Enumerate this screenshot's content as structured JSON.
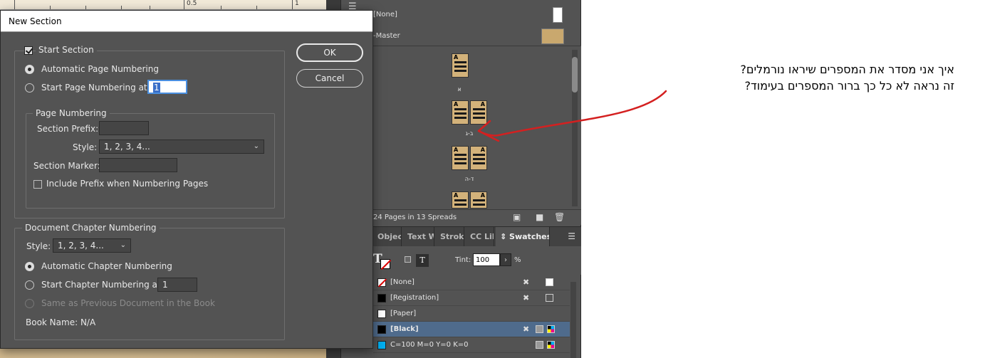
{
  "dialog": {
    "title": "New Section",
    "start_section_label": "Start Section",
    "auto_page_label": "Automatic Page Numbering",
    "start_page_label": "Start Page Numbering at:",
    "start_page_value": "1",
    "ok_label": "OK",
    "cancel_label": "Cancel",
    "page_numbering": {
      "group_label": "Page Numbering",
      "section_prefix_label": "Section Prefix:",
      "section_prefix_value": "",
      "style_label": "Style:",
      "style_value": "1, 2, 3, 4...",
      "section_marker_label": "Section Marker:",
      "section_marker_value": "",
      "include_prefix_label": "Include Prefix when Numbering Pages"
    },
    "chapter_numbering": {
      "group_label": "Document Chapter Numbering",
      "style_label": "Style:",
      "style_value": "1, 2, 3, 4...",
      "auto_chapter_label": "Automatic Chapter Numbering",
      "start_chapter_label": "Start Chapter Numbering at:",
      "start_chapter_value": "1",
      "same_as_prev_label": "Same as Previous Document in the Book",
      "book_name_label": "Book Name: N/A"
    }
  },
  "ruler": {
    "marks": [
      "0.5",
      "1"
    ]
  },
  "pages_panel": {
    "none_row": "[None]",
    "master_row": "-Master",
    "status": "24 Pages in 13 Spreads",
    "spread_labels": [
      "א",
      "ב-ג",
      "ד-ה"
    ],
    "thumb_marker": "A"
  },
  "panel_tabs": [
    "Object",
    "Text W",
    "Stroke",
    "CC Lib",
    "Swatches"
  ],
  "swatches": {
    "tint_label": "Tint:",
    "tint_value": "100",
    "tint_unit": "%",
    "tool_letter": "T",
    "items": [
      {
        "name": "[None]",
        "color": "none"
      },
      {
        "name": "[Registration]",
        "color": "#000000"
      },
      {
        "name": "[Paper]",
        "color": "#ffffff"
      },
      {
        "name": "[Black]",
        "color": "#000000"
      },
      {
        "name": "C=100 M=0 Y=0 K=0",
        "color": "#00aeef"
      }
    ]
  },
  "annotation": {
    "line1": "איך אני מסדר את המספרים שיראו נורמלים?",
    "line2": "זה נראה לא כל כך ברור המספרים בעימוד?",
    "arrow_color": "#d42020"
  }
}
